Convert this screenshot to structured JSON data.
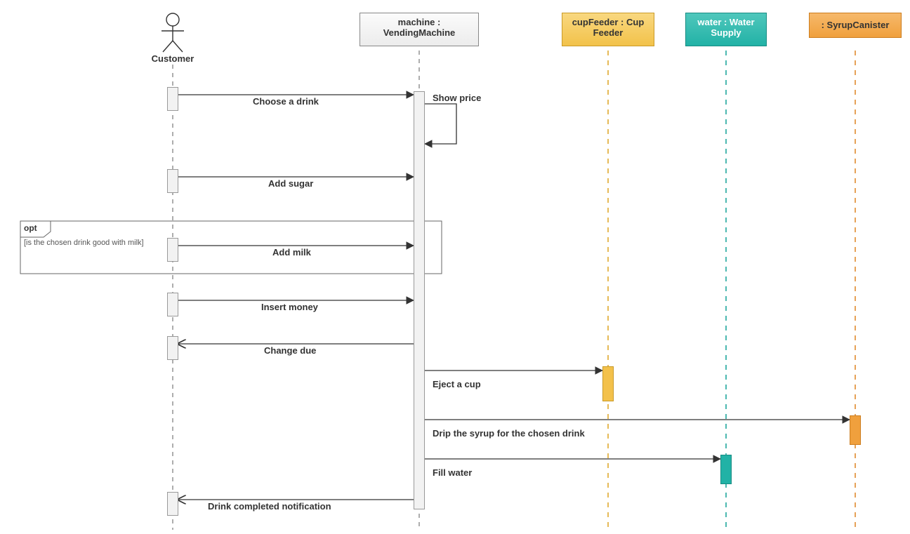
{
  "lifelines": {
    "customer": {
      "label": "Customer"
    },
    "machine": {
      "label": "machine : VendingMachine"
    },
    "cupFeeder": {
      "label": "cupFeeder : Cup Feeder"
    },
    "water": {
      "label": "water : Water Supply"
    },
    "syrup": {
      "label": ": SyrupCanister"
    }
  },
  "messages": {
    "chooseDrink": "Choose a drink",
    "showPrice": "Show price",
    "addSugar": "Add sugar",
    "addMilk": "Add milk",
    "insertMoney": "Insert money",
    "changeDue": "Change due",
    "ejectCup": "Eject a cup",
    "dripSyrup": "Drip the syrup for the chosen drink",
    "fillWater": "Fill water",
    "drinkDone": "Drink completed notification"
  },
  "fragment": {
    "operator": "opt",
    "guard": "[is the chosen drink good with milk]"
  },
  "chart_data": {
    "type": "uml_sequence_diagram",
    "lifelines": [
      {
        "id": "customer",
        "name": "Customer",
        "kind": "actor"
      },
      {
        "id": "machine",
        "name": "machine : VendingMachine",
        "kind": "object"
      },
      {
        "id": "cupFeeder",
        "name": "cupFeeder : Cup Feeder",
        "kind": "object"
      },
      {
        "id": "water",
        "name": "water : Water Supply",
        "kind": "object"
      },
      {
        "id": "syrup",
        "name": ": SyrupCanister",
        "kind": "object"
      }
    ],
    "messages": [
      {
        "seq": 1,
        "from": "customer",
        "to": "machine",
        "label": "Choose a drink",
        "type": "sync"
      },
      {
        "seq": 2,
        "from": "machine",
        "to": "machine",
        "label": "Show price",
        "type": "self"
      },
      {
        "seq": 3,
        "from": "customer",
        "to": "machine",
        "label": "Add sugar",
        "type": "sync"
      },
      {
        "seq": 4,
        "from": "customer",
        "to": "machine",
        "label": "Add milk",
        "type": "sync",
        "fragment": "opt1"
      },
      {
        "seq": 5,
        "from": "customer",
        "to": "machine",
        "label": "Insert money",
        "type": "sync"
      },
      {
        "seq": 6,
        "from": "machine",
        "to": "customer",
        "label": "Change due",
        "type": "return"
      },
      {
        "seq": 7,
        "from": "machine",
        "to": "cupFeeder",
        "label": "Eject a cup",
        "type": "sync"
      },
      {
        "seq": 8,
        "from": "machine",
        "to": "syrup",
        "label": "Drip the syrup for the chosen drink",
        "type": "sync"
      },
      {
        "seq": 9,
        "from": "machine",
        "to": "water",
        "label": "Fill water",
        "type": "sync"
      },
      {
        "seq": 10,
        "from": "machine",
        "to": "customer",
        "label": "Drink completed notification",
        "type": "return"
      }
    ],
    "fragments": [
      {
        "id": "opt1",
        "operator": "opt",
        "guard": "is the chosen drink good with milk",
        "covers_seq": [
          4
        ]
      }
    ]
  }
}
